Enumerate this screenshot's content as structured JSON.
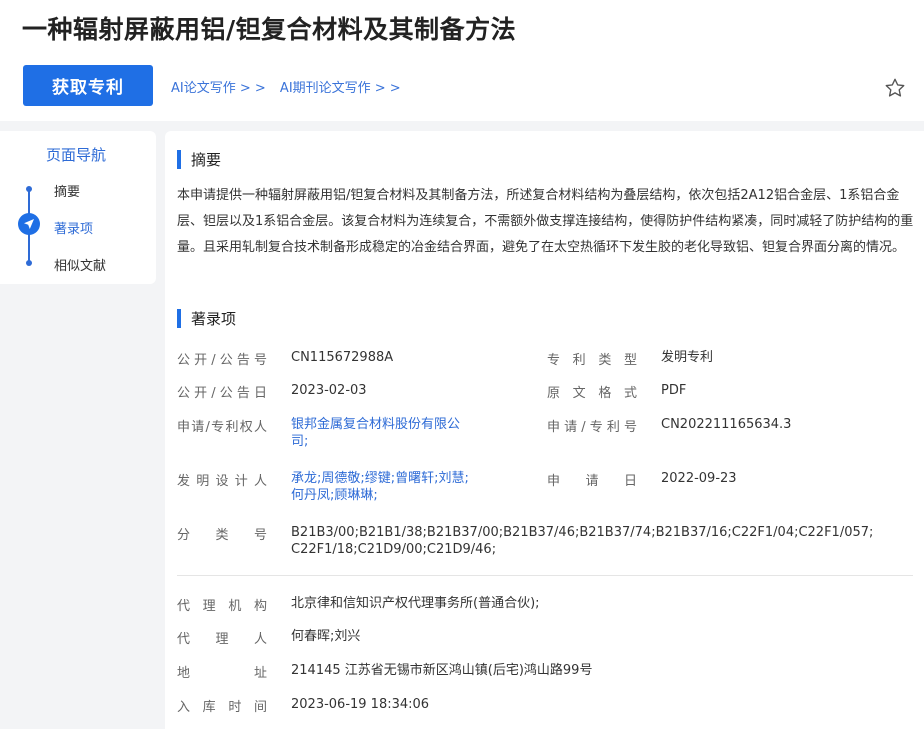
{
  "header": {
    "title": "一种辐射屏蔽用铝/钽复合材料及其制备方法",
    "get_button": "获取专利",
    "ai_links": [
      "AI论文写作 > >",
      "AI期刊论文写作 > >"
    ],
    "favorite_icon": "star-outline-icon"
  },
  "sidebar": {
    "title": "页面导航",
    "items": [
      {
        "label": "摘要",
        "active": false
      },
      {
        "label": "著录项",
        "active": true
      },
      {
        "label": "相似文献",
        "active": false
      }
    ],
    "accent": "#1f6fe5"
  },
  "abstract": {
    "heading": "摘要",
    "text": "本申请提供一种辐射屏蔽用铝/钽复合材料及其制备方法，所述复合材料结构为叠层结构，依次包括2A12铝合金层、1系铝合金层、钽层以及1系铝合金层。该复合材料为连续复合，不需额外做支撑连接结构，使得防护件结构紧凑，同时减轻了防护结构的重量。且采用轧制复合技术制备形成稳定的冶金结合界面，避免了在太空热循环下发生胶的老化导致铝、钽复合界面分离的情况。"
  },
  "bib": {
    "heading": "著录项",
    "pub_no_label": "公开/公告号",
    "pub_no": "CN115672988A",
    "type_label": "专利类型",
    "type": "发明专利",
    "pub_date_label": "公开/公告日",
    "pub_date": "2023-02-03",
    "format_label": "原文格式",
    "format": "PDF",
    "applicant_label": "申请/专利权人",
    "applicant_1": "银邦金属复合材料股份有限公",
    "applicant_2": "司;",
    "app_no_label": "申请/专利号",
    "app_no": "CN202211165634.3",
    "inventor_label": "发明设计人",
    "inventors_1": "承龙;周德敬;缪键;曾曙轩;刘慧;",
    "inventors_2": "何丹凤;顾琳琳;",
    "app_date_label": "申请日",
    "app_date": "2022-09-23",
    "class_label": "分类号",
    "class_1": "B21B3/00;B21B1/38;B21B37/00;B21B37/46;B21B37/74;B21B37/16;C22F1/04;C22F1/057;",
    "class_2": "C22F1/18;C21D9/00;C21D9/46;",
    "agency_label": "代理机构",
    "agency": "北京律和信知识产权代理事务所(普通合伙);",
    "agent_label": "代理人",
    "agent": "何春晖;刘兴",
    "address_label": "地址",
    "address": "214145 江苏省无锡市新区鸿山镇(后宅)鸿山路99号",
    "storage_label": "入库时间",
    "storage_time": "2023-06-19 18:34:06"
  }
}
